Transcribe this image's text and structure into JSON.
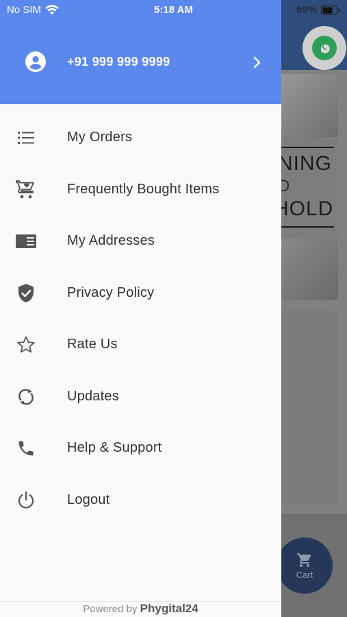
{
  "status_bar": {
    "carrier": "No SIM",
    "time": "5:18 AM",
    "battery": "69%"
  },
  "drawer": {
    "account": {
      "phone": "+91 999 999 9999"
    },
    "menu": [
      {
        "label": "My Orders",
        "icon": "list-icon"
      },
      {
        "label": "Frequently Bought Items",
        "icon": "cart-favorite-icon"
      },
      {
        "label": "My Addresses",
        "icon": "address-card-icon"
      },
      {
        "label": "Privacy Policy",
        "icon": "shield-check-icon"
      },
      {
        "label": "Rate Us",
        "icon": "star-outline-icon"
      },
      {
        "label": "Updates",
        "icon": "refresh-icon"
      },
      {
        "label": "Help & Support",
        "icon": "phone-icon"
      },
      {
        "label": "Logout",
        "icon": "power-icon"
      }
    ],
    "footer": {
      "powered_by": "Powered by",
      "brand": "Phygital24"
    }
  },
  "background": {
    "banner_text_1": "NING",
    "banner_text_2": "D",
    "banner_text_3": "HOLD",
    "cart_label": "Cart"
  },
  "colors": {
    "drawer_header": "#5b88ec",
    "drawer_bg": "#fafafa",
    "icon_gray": "#555555"
  }
}
